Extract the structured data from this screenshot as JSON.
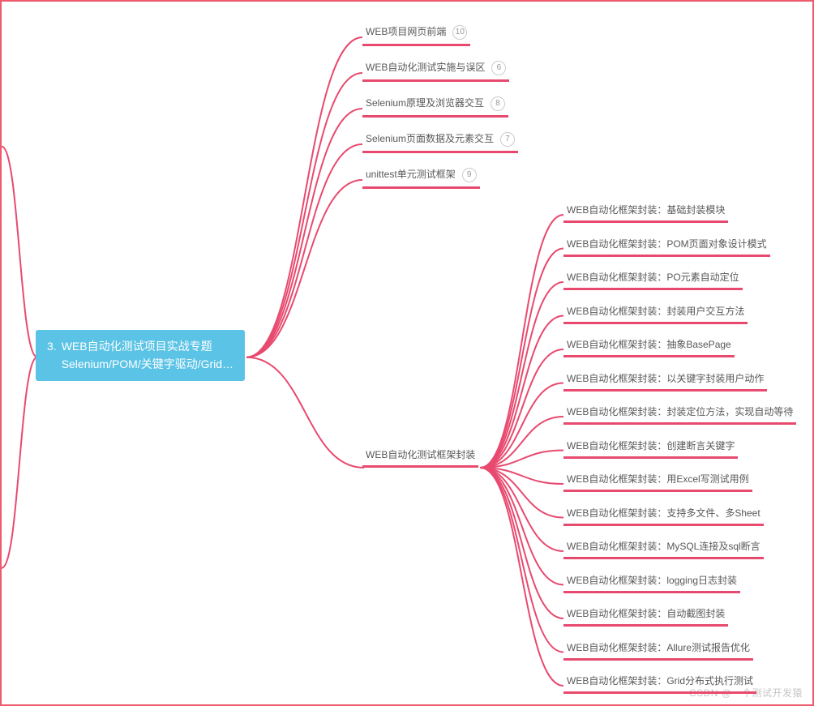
{
  "root": {
    "index": "3.",
    "line1": "WEB自动化测试项目实战专题",
    "line2": "Selenium/POM/关键字驱动/Grid…"
  },
  "group_top": [
    {
      "label": "WEB项目网页前端",
      "badge": "10"
    },
    {
      "label": "WEB自动化测试实施与误区",
      "badge": "6"
    },
    {
      "label": "Selenium原理及浏览器交互",
      "badge": "8"
    },
    {
      "label": "Selenium页面数据及元素交互",
      "badge": "7"
    },
    {
      "label": "unittest单元测试框架",
      "badge": "9"
    }
  ],
  "mid_node": {
    "label": "WEB自动化测试框架封装"
  },
  "group_sub": [
    "WEB自动化框架封装：基础封装模块",
    "WEB自动化框架封装：POM页面对象设计模式",
    "WEB自动化框架封装：PO元素自动定位",
    "WEB自动化框架封装：封装用户交互方法",
    "WEB自动化框架封装：抽象BasePage",
    "WEB自动化框架封装：以关键字封装用户动作",
    "WEB自动化框架封装：封装定位方法，实现自动等待",
    "WEB自动化框架封装：创建断言关键字",
    "WEB自动化框架封装：用Excel写测试用例",
    "WEB自动化框架封装：支持多文件、多Sheet",
    "WEB自动化框架封装：MySQL连接及sql断言",
    "WEB自动化框架封装：logging日志封装",
    "WEB自动化框架封装：自动截图封装",
    "WEB自动化框架封装：Allure测试报告优化",
    "WEB自动化框架封装：Grid分布式执行测试"
  ],
  "watermark": "CSDN @一个测试开发猿"
}
